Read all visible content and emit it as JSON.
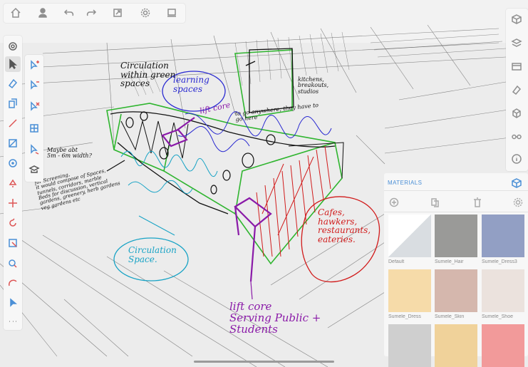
{
  "top_toolbar": [
    "home-icon",
    "user-icon",
    "undo-icon",
    "redo-icon",
    "export-icon",
    "settings-icon",
    "display-icon"
  ],
  "right_toolbar": [
    "cube-icon",
    "layers-icon",
    "scenes-icon",
    "eraser-icon",
    "components-icon",
    "glasses-icon",
    "info-icon"
  ],
  "left_tools": [
    "orbit-icon",
    "select-icon",
    "eraser-icon",
    "pushpull-icon",
    "pencil-icon",
    "rectangle-icon",
    "circle-icon",
    "paint-icon",
    "move-icon",
    "rotate-icon",
    "tape-icon",
    "tag-icon",
    "arc-icon",
    "pointer-icon",
    "more-icon"
  ],
  "colors": {
    "accent": "#4a8fd6",
    "ink_black": "#111111",
    "ink_green": "#2fb52f",
    "ink_blue": "#2a2ad1",
    "ink_purple": "#8a1aa8",
    "ink_teal": "#18a3c5",
    "ink_red": "#d11b1b"
  },
  "annotations": {
    "circulation": "Circulation\nwithin green\nspaces",
    "learning": "learning\nspaces",
    "lift_core_small": "lift core",
    "kitchens": "kitchens,\nbreakouts,\nstudios",
    "go_anywhere": "to go anywhere, they have to\ngo here",
    "maybe": "Maybe abt\n5m - 6m width?",
    "screening": "for Screening,\nit would compose of Spaces,\ntunnels, corridors, marble\nBeds for discussion, vertical\ngardens, greenery, herb gardens\nveg gardens etc",
    "circulation_space": "Circulation\nSpace.",
    "cafes": "Cafes,\nhawkers,\nrestaurants,\neateries.",
    "lift_core_serving": "lift core\nServing Public +\nStudents"
  },
  "materials": {
    "title": "MATERIALS",
    "swatches": [
      {
        "label": "Default",
        "color": "#d9dde1"
      },
      {
        "label": "Sumele_Hair",
        "color": "#9a9a98"
      },
      {
        "label": "Sumele_Dress3",
        "color": "#929fc4"
      },
      {
        "label": "Sumele_Dress",
        "color": "#f6dba9"
      },
      {
        "label": "Sumele_Skin",
        "color": "#d5b7ad"
      },
      {
        "label": "Sumele_Shoe",
        "color": "#ebe2dd"
      },
      {
        "label": "",
        "color": "#cfcfcf"
      },
      {
        "label": "",
        "color": "#f0d29a"
      },
      {
        "label": "",
        "color": "#f29a9a"
      }
    ]
  }
}
